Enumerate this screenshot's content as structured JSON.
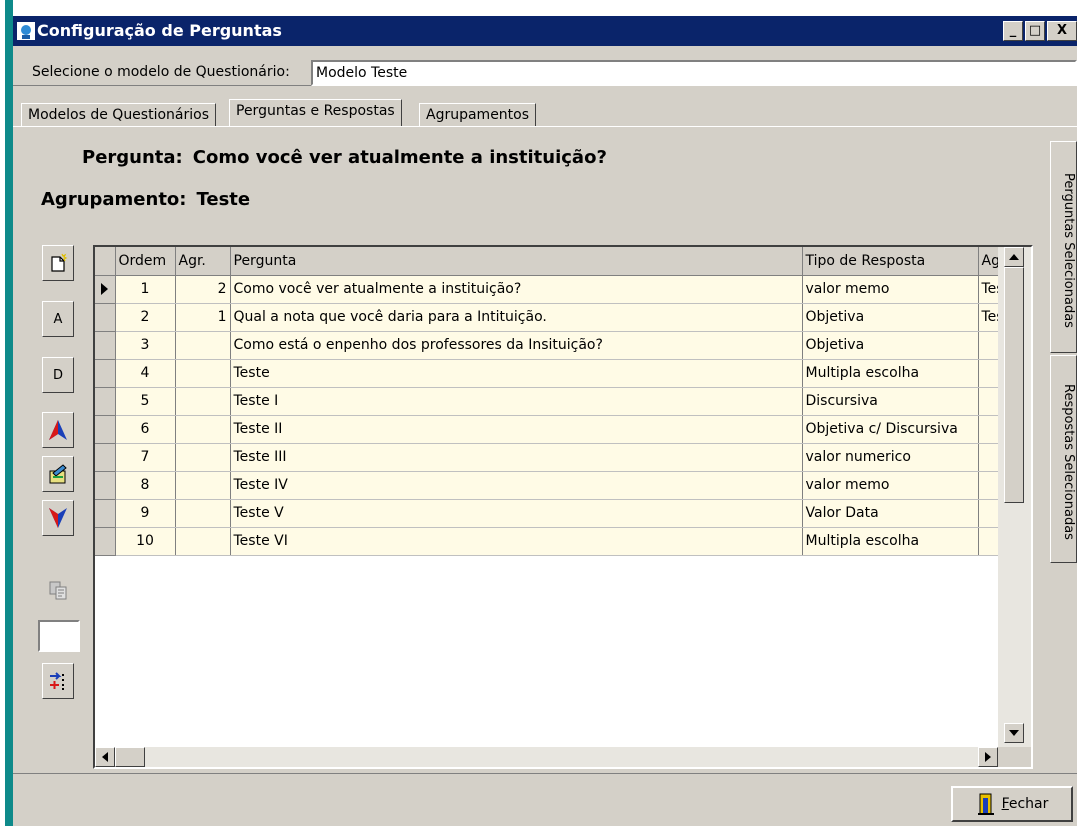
{
  "window": {
    "title": "Configuração de Perguntas",
    "buttons": [
      "_",
      "□",
      "X"
    ]
  },
  "model_selector": {
    "label": "Selecione o modelo de Questionário:",
    "value": "Modelo Teste"
  },
  "tabs": [
    {
      "label": "Modelos de Questionários",
      "active": false
    },
    {
      "label": "Perguntas e Respostas",
      "active": true
    },
    {
      "label": "Agrupamentos",
      "active": false
    }
  ],
  "current": {
    "pergunta_label": "Pergunta:",
    "pergunta_value": "Como você ver atualmente a instituição?",
    "agrupamento_label": "Agrupamento:",
    "agrupamento_value": "Teste"
  },
  "toolbar": {
    "a_label": "A",
    "d_label": "D",
    "icons": [
      "new-document-icon",
      "move-up-icon",
      "edit-icon",
      "move-down-icon",
      "copy-icon",
      "sort-icon"
    ]
  },
  "grid": {
    "columns": [
      "Ordem",
      "Agr.",
      "Pergunta",
      "Tipo de Resposta",
      "Agru"
    ],
    "rows": [
      {
        "ordem": "1",
        "agr": "2",
        "pergunta": "Como você ver atualmente a instituição?",
        "tipo": "valor memo",
        "agru": "Test"
      },
      {
        "ordem": "2",
        "agr": "1",
        "pergunta": "Qual a nota que você daria para a Intituição.",
        "tipo": "Objetiva",
        "agru": "Test"
      },
      {
        "ordem": "3",
        "agr": "",
        "pergunta": "Como está o enpenho dos professores da Insituição?",
        "tipo": "Objetiva",
        "agru": ""
      },
      {
        "ordem": "4",
        "agr": "",
        "pergunta": "Teste",
        "tipo": "Multipla escolha",
        "agru": ""
      },
      {
        "ordem": "5",
        "agr": "",
        "pergunta": "Teste I",
        "tipo": "Discursiva",
        "agru": ""
      },
      {
        "ordem": "6",
        "agr": "",
        "pergunta": "Teste II",
        "tipo": "Objetiva c/ Discursiva",
        "agru": ""
      },
      {
        "ordem": "7",
        "agr": "",
        "pergunta": "Teste III",
        "tipo": "valor numerico",
        "agru": ""
      },
      {
        "ordem": "8",
        "agr": "",
        "pergunta": "Teste IV",
        "tipo": "valor memo",
        "agru": ""
      },
      {
        "ordem": "9",
        "agr": "",
        "pergunta": "Teste V",
        "tipo": "Valor Data",
        "agru": ""
      },
      {
        "ordem": "10",
        "agr": "",
        "pergunta": "Teste VI",
        "tipo": "Multipla escolha",
        "agru": ""
      }
    ]
  },
  "side_tabs": [
    "Perguntas Selecionadas",
    "Respostas Selecionadas"
  ],
  "footer": {
    "close_label": "Fechar",
    "close_icon": "door-exit-icon"
  },
  "colors": {
    "titlebar": "#0a246a",
    "row_background": "#fffbe6",
    "window_face": "#d4d0c8"
  }
}
